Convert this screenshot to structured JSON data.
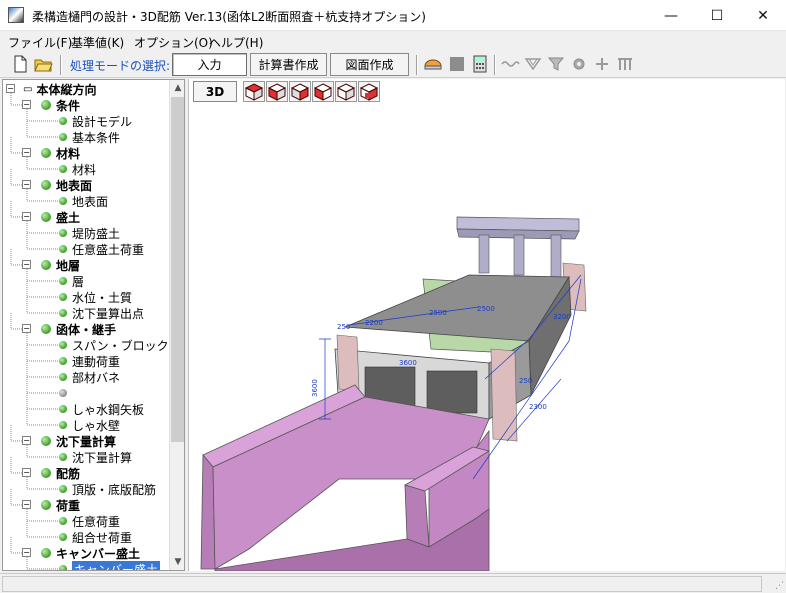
{
  "window": {
    "title": "柔構造樋門の設計・3D配筋 Ver.13(函体L2断面照査＋杭支持オプション)",
    "minimize": "—",
    "maximize": "☐",
    "close": "✕"
  },
  "menu": {
    "items": [
      "ファイル(F)",
      "基準値(K)",
      "オプション(O)",
      "ヘルプ(H)"
    ]
  },
  "toolbar": {
    "mode_label": "処理モードの選択:",
    "mode_buttons": [
      "入力",
      "計算書作成",
      "図面作成"
    ]
  },
  "tree": {
    "root": "本体縦方向",
    "groups": [
      {
        "label": "条件",
        "children": [
          "設計モデル",
          "基本条件"
        ]
      },
      {
        "label": "材料",
        "children": [
          "材料"
        ]
      },
      {
        "label": "地表面",
        "children": [
          "地表面"
        ]
      },
      {
        "label": "盛土",
        "children": [
          "堤防盛土",
          "任意盛土荷重"
        ]
      },
      {
        "label": "地層",
        "children": [
          "層",
          "水位・土質",
          "沈下量算出点"
        ]
      },
      {
        "label": "函体・継手",
        "children": [
          "スパン・ブロック",
          "連動荷重",
          "部材バネ",
          "",
          "しゃ水鋼矢板",
          "しゃ水壁"
        ]
      },
      {
        "label": "沈下量計算",
        "children": [
          "沈下量計算"
        ]
      },
      {
        "label": "配筋",
        "children": [
          "頂版・底版配筋"
        ]
      },
      {
        "label": "荷重",
        "children": [
          "任意荷重",
          "組合せ荷重"
        ]
      },
      {
        "label": "キャンバー盛土",
        "children": [
          "キャンバー盛土"
        ]
      }
    ]
  },
  "view": {
    "mode_button": "3D",
    "dimensions": [
      "3600",
      "3600",
      "2500",
      "2500",
      "2200",
      "250",
      "250",
      "3200",
      "2300"
    ]
  },
  "colors": {
    "accent": "#1a50c0",
    "selection": "#3a78d8",
    "wingwall": "#c98fc9",
    "box": "#808080",
    "dim": "#1a3cc8"
  }
}
